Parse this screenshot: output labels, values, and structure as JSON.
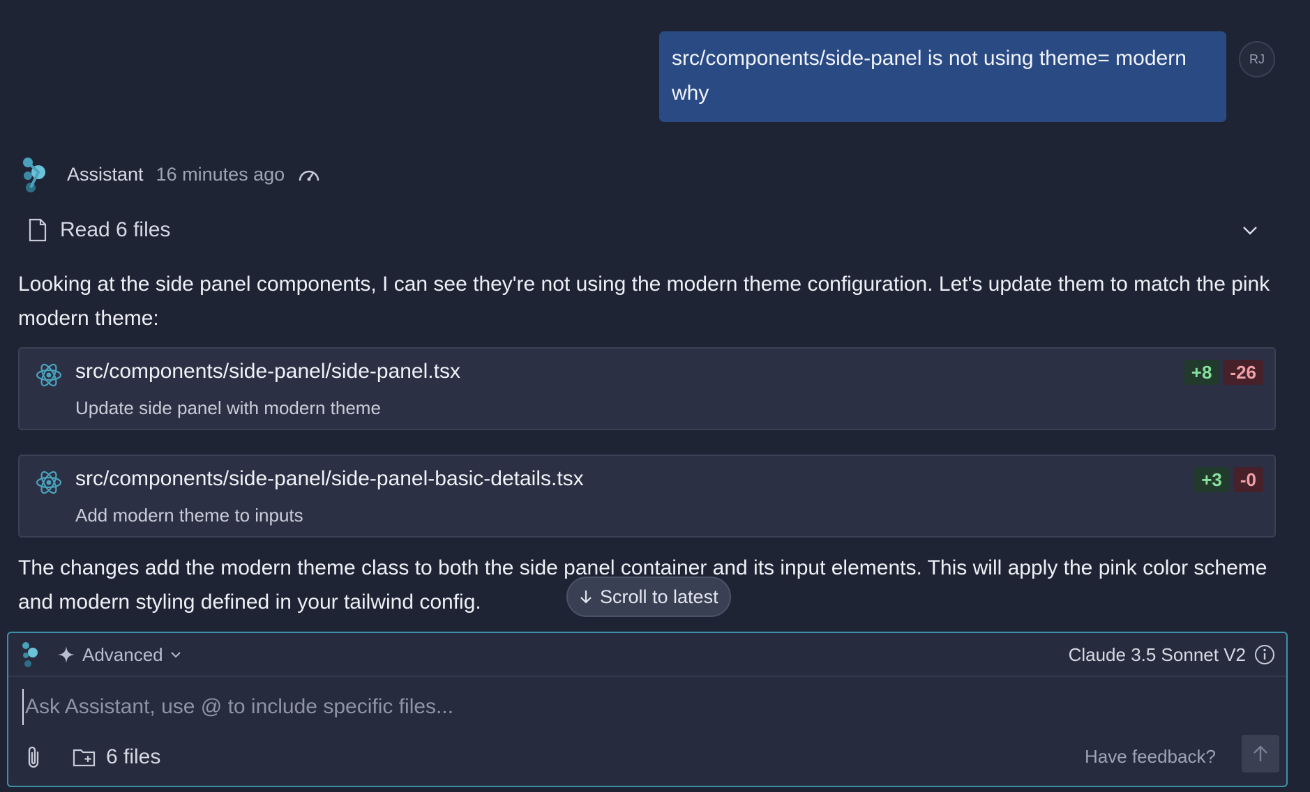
{
  "user_message": {
    "text": "src/components/side-panel is not using theme= modern why",
    "avatar_initials": "RJ"
  },
  "assistant": {
    "name": "Assistant",
    "time": "16 minutes ago",
    "read_files_label": "Read 6 files",
    "intro": "Looking at the side panel components, I can see they're not using the modern theme configuration. Let's update them to match the pink modern theme:",
    "changes": [
      {
        "path": "src/components/side-panel/side-panel.tsx",
        "description": "Update side panel with modern theme",
        "additions": "+8",
        "deletions": "-26"
      },
      {
        "path": "src/components/side-panel/side-panel-basic-details.tsx",
        "description": "Add modern theme to inputs",
        "additions": "+3",
        "deletions": "-0"
      }
    ],
    "summary": "The changes add the modern theme class to both the side panel container and its input elements. This will apply the pink color scheme and modern styling defined in your tailwind config."
  },
  "scroll_to_latest": "Scroll to latest",
  "composer": {
    "mode_label": "Advanced",
    "model_label": "Claude 3.5 Sonnet V2",
    "placeholder": "Ask Assistant, use @ to include specific files...",
    "files_label": "6 files",
    "feedback_label": "Have feedback?"
  },
  "icons": {
    "assistant_logo": "assistant-logo-icon",
    "gauge": "gauge-icon",
    "file": "file-icon",
    "chevron": "chevron-down-icon",
    "react": "react-icon",
    "sparkle": "sparkle-icon",
    "info": "info-icon",
    "attach": "paperclip-icon",
    "folder": "folder-plus-icon",
    "send": "arrow-up-icon"
  },
  "colors": {
    "background": "#1f2435",
    "user_bubble": "#2a4a84",
    "card": "#2b3044",
    "addition_text": "#87e09d",
    "deletion_text": "#f0a0a8",
    "composer_border": "#3f8fa8",
    "brand_teal": "#4aa3bd"
  }
}
